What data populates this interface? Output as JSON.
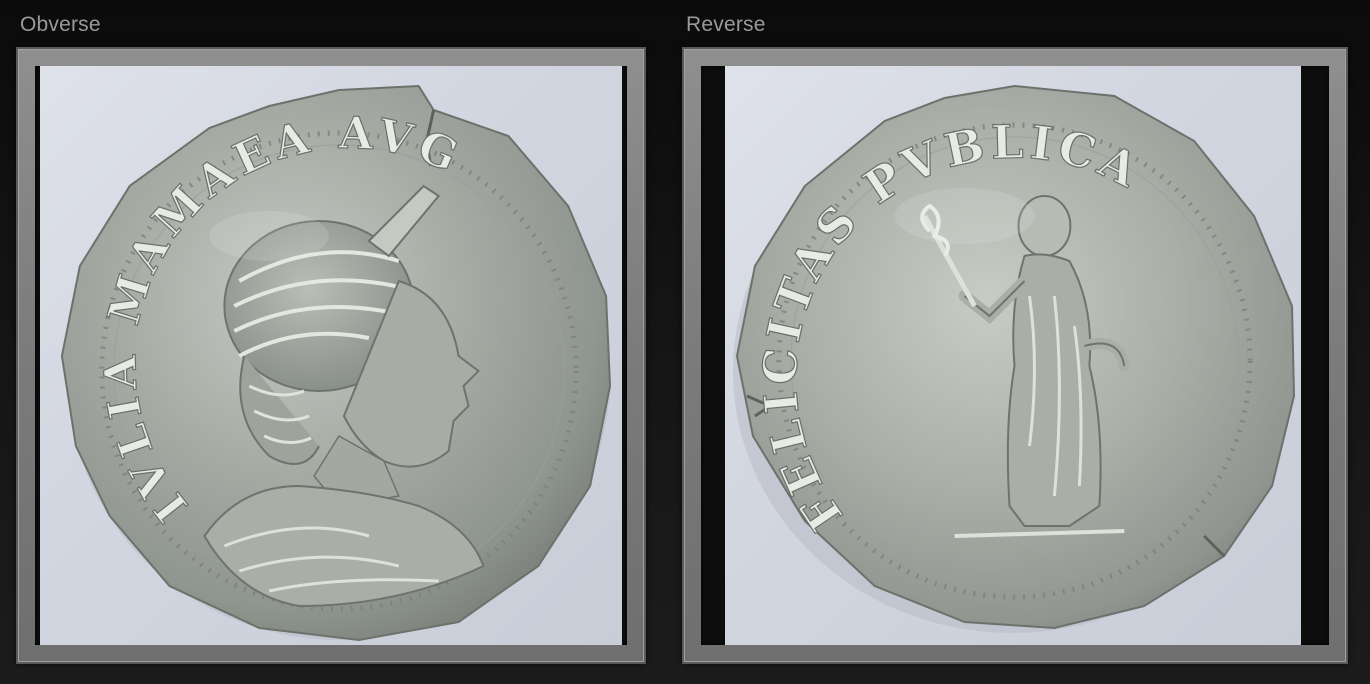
{
  "panels": {
    "obverse": {
      "label": "Obverse",
      "legend": "IVLIA MAMAEA AVG"
    },
    "reverse": {
      "label": "Reverse",
      "legend": "FELICITAS PVBLICA"
    }
  },
  "colors": {
    "background": "#111111",
    "frame": "#7f7f7f",
    "label": "#9a9a9a",
    "photo_background": "#d6d9e2",
    "coin_silver": "#a9ada6"
  }
}
